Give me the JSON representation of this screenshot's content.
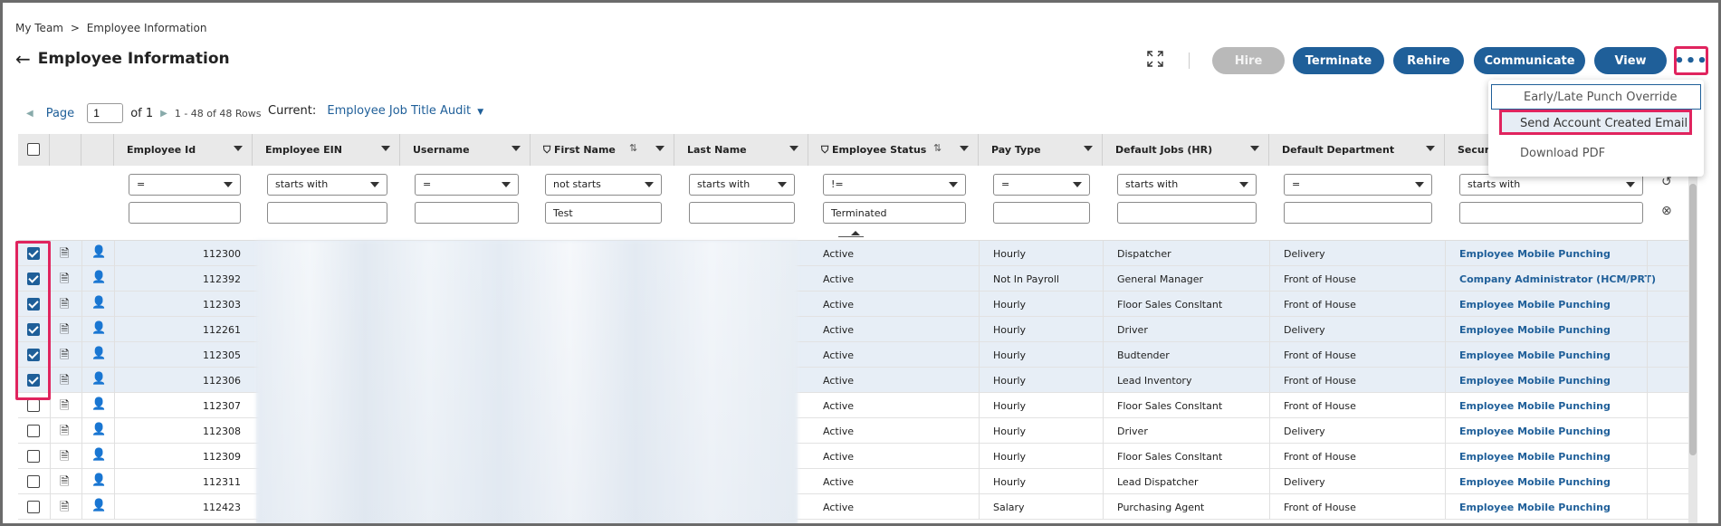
{
  "breadcrumb": {
    "root": "My Team",
    "sep": ">",
    "current": "Employee Information"
  },
  "page_title": "Employee Information",
  "actions": {
    "hire": "Hire",
    "terminate": "Terminate",
    "rehire": "Rehire",
    "communicate": "Communicate",
    "view": "View",
    "more": "•••"
  },
  "pager": {
    "page_label": "Page",
    "page_value": "1",
    "of": "of 1",
    "rows": "1 - 48 of 48 Rows"
  },
  "current": {
    "label": "Current:",
    "view": "Employee Job Title Audit"
  },
  "columns": [
    {
      "key": "emp_id",
      "label": "Employee Id"
    },
    {
      "key": "ein",
      "label": "Employee EIN"
    },
    {
      "key": "username",
      "label": "Username"
    },
    {
      "key": "first",
      "label": "First Name"
    },
    {
      "key": "last",
      "label": "Last Name"
    },
    {
      "key": "status",
      "label": "Employee Status"
    },
    {
      "key": "paytype",
      "label": "Pay Type"
    },
    {
      "key": "jobs",
      "label": "Default Jobs (HR)"
    },
    {
      "key": "dept",
      "label": "Default Department"
    },
    {
      "key": "security",
      "label": "Securi"
    }
  ],
  "filters": [
    {
      "op": "=",
      "value": ""
    },
    {
      "op": "starts with",
      "value": ""
    },
    {
      "op": "=",
      "value": ""
    },
    {
      "op": "not starts",
      "value": "Test"
    },
    {
      "op": "starts with",
      "value": ""
    },
    {
      "op": "!=",
      "value": "Terminated"
    },
    {
      "op": "=",
      "value": ""
    },
    {
      "op": "starts with",
      "value": ""
    },
    {
      "op": "=",
      "value": ""
    },
    {
      "op": "starts with",
      "value": ""
    }
  ],
  "rows": [
    {
      "id": "112300",
      "status": "Active",
      "pay": "Hourly",
      "job": "Dispatcher",
      "dept": "Delivery",
      "sec": "Employee Mobile Punching",
      "checked": true
    },
    {
      "id": "112392",
      "status": "Active",
      "pay": "Not In Payroll",
      "job": "General Manager",
      "dept": "Front of House",
      "sec": "Company Administrator (HCM/PRT)",
      "checked": true
    },
    {
      "id": "112303",
      "status": "Active",
      "pay": "Hourly",
      "job": "Floor Sales Consltant",
      "dept": "Front of House",
      "sec": "Employee Mobile Punching",
      "checked": true
    },
    {
      "id": "112261",
      "status": "Active",
      "pay": "Hourly",
      "job": "Driver",
      "dept": "Delivery",
      "sec": "Employee Mobile Punching",
      "checked": true
    },
    {
      "id": "112305",
      "status": "Active",
      "pay": "Hourly",
      "job": "Budtender",
      "dept": "Front of House",
      "sec": "Employee Mobile Punching",
      "checked": true
    },
    {
      "id": "112306",
      "status": "Active",
      "pay": "Hourly",
      "job": "Lead Inventory",
      "dept": "Front of House",
      "sec": "Employee Mobile Punching",
      "checked": true
    },
    {
      "id": "112307",
      "status": "Active",
      "pay": "Hourly",
      "job": "Floor Sales Consltant",
      "dept": "Front of House",
      "sec": "Employee Mobile Punching",
      "checked": false
    },
    {
      "id": "112308",
      "status": "Active",
      "pay": "Hourly",
      "job": "Driver",
      "dept": "Delivery",
      "sec": "Employee Mobile Punching",
      "checked": false
    },
    {
      "id": "112309",
      "status": "Active",
      "pay": "Hourly",
      "job": "Floor Sales Consltant",
      "dept": "Front of House",
      "sec": "Employee Mobile Punching",
      "checked": false
    },
    {
      "id": "112311",
      "status": "Active",
      "pay": "Hourly",
      "job": "Lead Dispatcher",
      "dept": "Delivery",
      "sec": "Employee Mobile Punching",
      "checked": false
    },
    {
      "id": "112423",
      "status": "Active",
      "pay": "Salary",
      "job": "Purchasing Agent",
      "dept": "Front of House",
      "sec": "Employee Mobile Punching",
      "checked": false
    }
  ],
  "menu": {
    "item1": "Early/Late Punch Override",
    "item2": "Send Account Created Email",
    "item3": "Download PDF"
  },
  "colors": {
    "accent": "#1f5f99",
    "highlight": "#e0245e",
    "selected_row": "#e7eef6"
  }
}
